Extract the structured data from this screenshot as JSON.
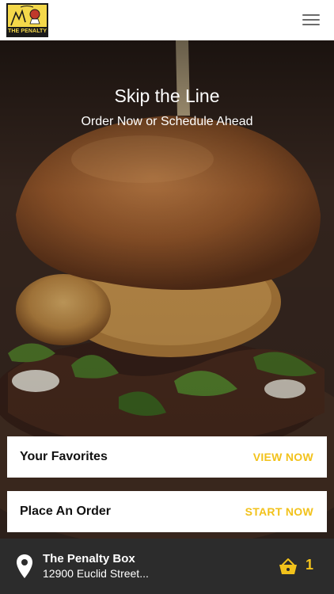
{
  "header": {
    "logo_text": "THE PENALTY BOX",
    "menu_icon": "hamburger-menu-icon"
  },
  "hero": {
    "title": "Skip the Line",
    "subtitle": "Order Now or Schedule Ahead"
  },
  "cards": {
    "favorites": {
      "label": "Your Favorites",
      "action": "VIEW NOW"
    },
    "order": {
      "label": "Place An Order",
      "action": "START NOW"
    }
  },
  "footer": {
    "location_icon": "map-pin-icon",
    "location_name": "The Penalty Box",
    "location_address": "12900 Euclid Street...",
    "basket_icon": "basket-icon",
    "basket_count": "1"
  },
  "colors": {
    "accent": "#f2c21b",
    "footer_bg": "#2c2c2c",
    "card_bg": "#ffffff",
    "header_bg": "#ffffff"
  }
}
